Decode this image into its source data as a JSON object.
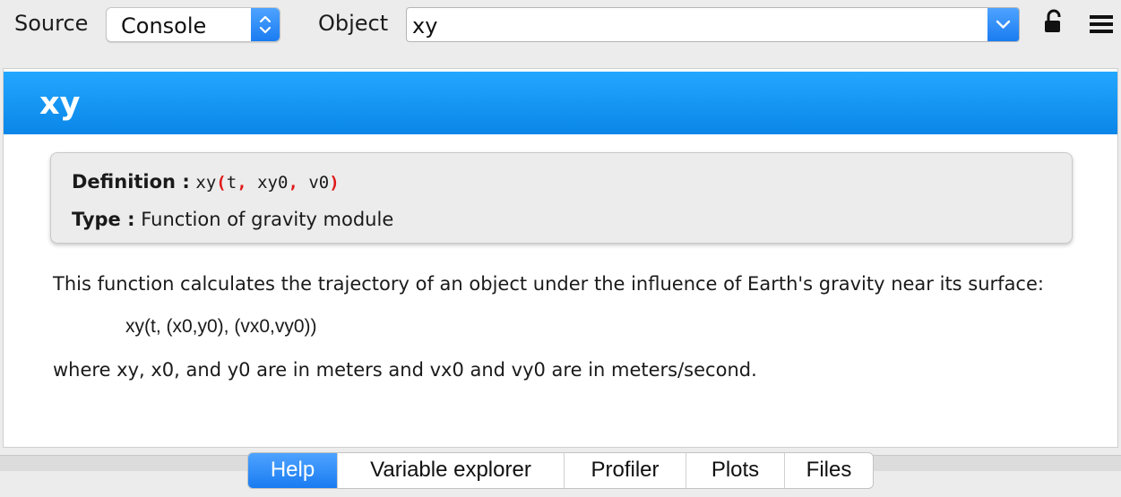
{
  "toolbar": {
    "source_label": "Source",
    "source_value": "Console",
    "object_label": "Object",
    "object_value": "xy"
  },
  "help": {
    "title": "xy",
    "definition_label": "Definition :",
    "definition_func": "xy",
    "definition_args": [
      "t",
      "xy0",
      "v0"
    ],
    "type_label": "Type :",
    "type_value": "Function of gravity module",
    "paragraph1": "This function calculates the trajectory of an object under the influence of Earth's gravity near its surface:",
    "formula": "xy(t, (x0,y0), (vx0,vy0))",
    "paragraph2": "where xy, x0, and y0 are in meters and vx0 and vy0 are in meters/second."
  },
  "tabs": [
    {
      "label": "Help",
      "active": true
    },
    {
      "label": "Variable explorer",
      "active": false
    },
    {
      "label": "Profiler",
      "active": false
    },
    {
      "label": "Plots",
      "active": false
    },
    {
      "label": "Files",
      "active": false
    }
  ],
  "colors": {
    "accent": "#1a7cf1",
    "banner": "#0a86e8",
    "syntax_red": "#e01818"
  },
  "icons": [
    "stepper-arrows-icon",
    "chevron-down-icon",
    "unlock-icon",
    "hamburger-menu-icon"
  ]
}
